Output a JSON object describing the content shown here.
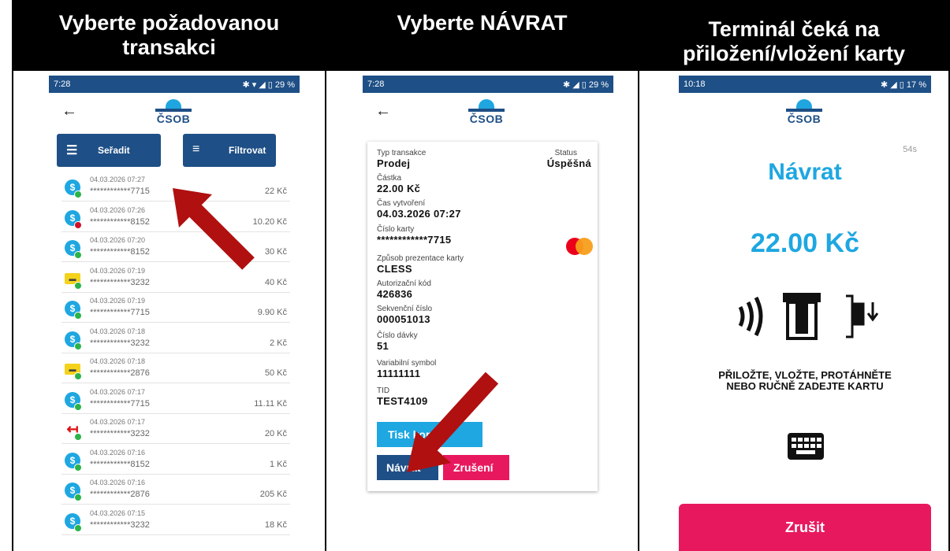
{
  "columns": [
    {
      "header": "Vyberte požadovanou\ntransakci"
    },
    {
      "header": "Vyberte NÁVRAT"
    },
    {
      "header": "Terminál čeká na\npřiložení/vložení karty"
    }
  ],
  "screen1": {
    "time": "7:28",
    "status_icons": "✱ ▾ ◢ ▯ 29 %",
    "sort_label": "Seřadit",
    "filter_label": "Filtrovat",
    "transactions": [
      {
        "date": "04.03.2026 07:27",
        "card": "************7715",
        "amount": "22 Kč",
        "type": "ok"
      },
      {
        "date": "04.03.2026 07:26",
        "card": "************8152",
        "amount": "10.20 Kč",
        "type": "fail"
      },
      {
        "date": "04.03.2026 07:20",
        "card": "************8152",
        "amount": "30 Kč",
        "type": "ok"
      },
      {
        "date": "04.03.2026 07:19",
        "card": "************3232",
        "amount": "40 Kč",
        "type": "card"
      },
      {
        "date": "04.03.2026 07:19",
        "card": "************7715",
        "amount": "9.90 Kč",
        "type": "ok"
      },
      {
        "date": "04.03.2026 07:18",
        "card": "************3232",
        "amount": "2 Kč",
        "type": "ok"
      },
      {
        "date": "04.03.2026 07:18",
        "card": "************2876",
        "amount": "50 Kč",
        "type": "card"
      },
      {
        "date": "04.03.2026 07:17",
        "card": "************7715",
        "amount": "11.11 Kč",
        "type": "ok"
      },
      {
        "date": "04.03.2026 07:17",
        "card": "************3232",
        "amount": "20 Kč",
        "type": "return"
      },
      {
        "date": "04.03.2026 07:16",
        "card": "************8152",
        "amount": "1 Kč",
        "type": "ok"
      },
      {
        "date": "04.03.2026 07:16",
        "card": "************2876",
        "amount": "205 Kč",
        "type": "ok"
      },
      {
        "date": "04.03.2026 07:15",
        "card": "************3232",
        "amount": "18 Kč",
        "type": "ok"
      }
    ]
  },
  "screen2": {
    "time": "7:28",
    "status_icons": "✱ ◢ ▯ 29 %",
    "fields": {
      "type_label": "Typ transakce",
      "type_value": "Prodej",
      "status_label": "Status",
      "status_value": "Úspěšná",
      "amount_label": "Částka",
      "amount_value": "22.00 Kč",
      "created_label": "Čas vytvoření",
      "created_value": "04.03.2026 07:27",
      "card_label": "Číslo karty",
      "card_value": "************7715",
      "presentation_label": "Způsob prezentace karty",
      "presentation_value": "CLESS",
      "auth_label": "Autorizační kód",
      "auth_value": "426836",
      "seq_label": "Sekvenční číslo",
      "seq_value": "000051013",
      "batch_label": "Číslo dávky",
      "batch_value": "51",
      "vs_label": "Variabilní symbol",
      "vs_value": "11111111",
      "tid_label": "TID",
      "tid_value": "TEST4109"
    },
    "print_label": "Tisk kopii",
    "return_label": "Návrat",
    "cancel_label": "Zrušení"
  },
  "screen3": {
    "time": "10:18",
    "status_icons": "✱ ◢ ▯ 17 %",
    "seconds": "54s",
    "title": "Návrat",
    "amount": "22.00 Kč",
    "instruction": "PŘILOŽTE, VLOŽTE, PROTÁHNĚTE\nNEBO RUČNĚ ZADEJTE KARTU",
    "cancel_label": "Zrušit"
  },
  "logo_text": "ČSOB",
  "colors": {
    "brand": "#1e4f86",
    "accent": "#1ea7e1",
    "danger": "#e8185f",
    "arrow": "#b01010"
  }
}
